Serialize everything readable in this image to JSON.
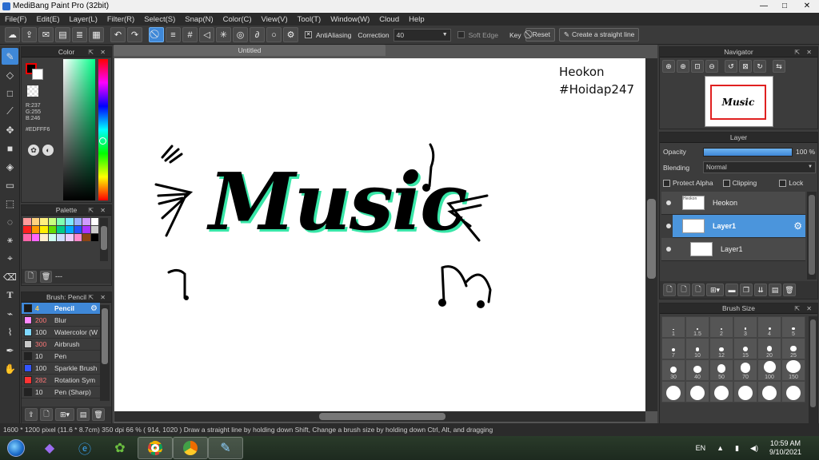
{
  "app": {
    "title": "MediBang Paint Pro (32bit)"
  },
  "window": {
    "min": "—",
    "max": "□",
    "close": "✕"
  },
  "menu": [
    "File(F)",
    "Edit(E)",
    "Layer(L)",
    "Filter(R)",
    "Select(S)",
    "Snap(N)",
    "Color(C)",
    "View(V)",
    "Tool(T)",
    "Window(W)",
    "Cloud",
    "Help"
  ],
  "toolbar": {
    "antialias_label": "AntiAliasing",
    "correction_label": "Correction",
    "correction_value": "40",
    "soft_edge_label": "Soft Edge",
    "key_label": "Key",
    "reset_label": "Reset",
    "straight_line_label": "Create a straight line"
  },
  "color_panel": {
    "title": "Color",
    "r": "R:237",
    "g": "G:255",
    "b": "B:246",
    "hex": "#EDFFF6",
    "accent": "#3f88d8"
  },
  "palette_panel": {
    "title": "Palette",
    "extra": "---"
  },
  "brush_panel": {
    "title": "Brush: Pencil",
    "items": [
      {
        "size": "4",
        "name": "Pencil",
        "color": "#1a1a1a",
        "selected": true
      },
      {
        "size": "200",
        "name": "Blur",
        "color": "#ff88ff",
        "selected": false
      },
      {
        "size": "100",
        "name": "Watercolor (W",
        "color": "#7fd8ff",
        "selected": false
      },
      {
        "size": "300",
        "name": "Airbrush",
        "color": "#c8c8c8",
        "selected": false
      },
      {
        "size": "10",
        "name": "Pen",
        "color": "#222222",
        "selected": false
      },
      {
        "size": "100",
        "name": "Sparkle Brush",
        "color": "#3355ff",
        "selected": false
      },
      {
        "size": "282",
        "name": "Rotation Sym",
        "color": "#ff3333",
        "selected": false
      },
      {
        "size": "10",
        "name": "Pen (Sharp)",
        "color": "#222222",
        "selected": false
      }
    ]
  },
  "canvas": {
    "tab_title": "Untitled",
    "watermark_line1": "Heokon",
    "watermark_line2": "#Hoidap247",
    "artwork_text": "Music"
  },
  "navigator": {
    "title": "Navigator"
  },
  "layer_panel": {
    "title": "Layer",
    "opacity_label": "Opacity",
    "opacity_value": "100 %",
    "opacity_level": 1.0,
    "blending_label": "Blending",
    "blending_value": "Normal",
    "protect_alpha_label": "Protect Alpha",
    "clipping_label": "Clipping",
    "lock_label": "Lock",
    "layers": [
      {
        "name": "Heokon",
        "selected": false
      },
      {
        "name": "Layer1",
        "selected": true
      },
      {
        "name": "Layer1",
        "selected": false
      }
    ]
  },
  "brush_size_panel": {
    "title": "Brush Size",
    "sizes": [
      "1",
      "1.5",
      "2",
      "3",
      "4",
      "5",
      "7",
      "10",
      "12",
      "15",
      "20",
      "25",
      "30",
      "40",
      "50",
      "70",
      "100",
      "150",
      "",
      "",
      "",
      "",
      "",
      ""
    ]
  },
  "status": "1600 * 1200 pixel   (11.6 * 8.7cm)   350 dpi   66 %   ( 914, 1020 )   Draw a straight line by holding down Shift, Change a brush size by holding down Ctrl, Alt, and dragging",
  "taskbar": {
    "lang": "EN",
    "time": "10:59 AM",
    "date": "9/10/2021"
  }
}
